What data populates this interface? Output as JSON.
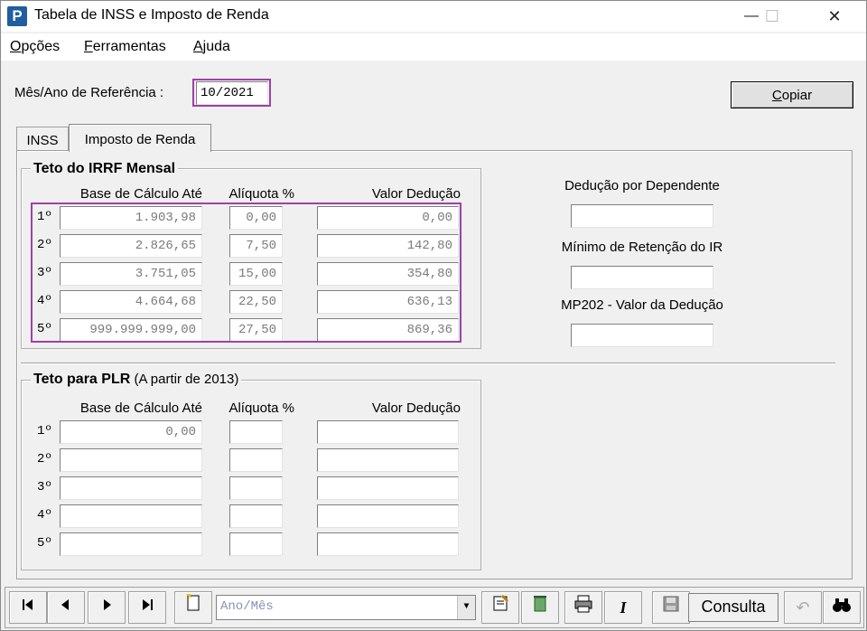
{
  "window": {
    "app_icon": "P",
    "title": "Tabela de INSS e Imposto de Renda",
    "minimize": "—",
    "maximize": "☐",
    "close": "✕"
  },
  "menu": [
    {
      "label": "Opções",
      "underline_char": "O",
      "rest": "pções"
    },
    {
      "label": "Ferramentas",
      "underline_char": "F",
      "rest": "erramentas"
    },
    {
      "label": "Ajuda",
      "underline_char": "A",
      "rest": "juda"
    }
  ],
  "reference": {
    "label": "Mês/Ano de Referência :",
    "value": "10/2021"
  },
  "copy_button": {
    "underline_char": "C",
    "rest": "opiar"
  },
  "tabs": [
    {
      "label": "INSS"
    },
    {
      "label": "Imposto de Renda"
    }
  ],
  "irrf": {
    "title": "Teto do IRRF Mensal",
    "headers": {
      "base": "Base de Cálculo Até",
      "aliquota": "Alíquota %",
      "deducao": "Valor Dedução"
    },
    "rows": [
      {
        "label": "1º",
        "base": "1.903,98",
        "aliquota": "0,00",
        "deducao": "0,00"
      },
      {
        "label": "2º",
        "base": "2.826,65",
        "aliquota": "7,50",
        "deducao": "142,80"
      },
      {
        "label": "3º",
        "base": "3.751,05",
        "aliquota": "15,00",
        "deducao": "354,80"
      },
      {
        "label": "4º",
        "base": "4.664,68",
        "aliquota": "22,50",
        "deducao": "636,13"
      },
      {
        "label": "5º",
        "base": "999.999.999,00",
        "aliquota": "27,50",
        "deducao": "869,36"
      }
    ]
  },
  "plr": {
    "title": "Teto para PLR",
    "subtitle": "(A partir de 2013)",
    "headers": {
      "base": "Base de Cálculo Até",
      "aliquota": "Alíquota %",
      "deducao": "Valor Dedução"
    },
    "rows": [
      {
        "label": "1º",
        "base": "0,00",
        "aliquota": "",
        "deducao": ""
      },
      {
        "label": "2º",
        "base": "",
        "aliquota": "",
        "deducao": ""
      },
      {
        "label": "3º",
        "base": "",
        "aliquota": "",
        "deducao": ""
      },
      {
        "label": "4º",
        "base": "",
        "aliquota": "",
        "deducao": ""
      },
      {
        "label": "5º",
        "base": "",
        "aliquota": "",
        "deducao": ""
      }
    ]
  },
  "side": {
    "dependente_label": "Dedução por Dependente",
    "dependente_value": "",
    "minimo_label": "Mínimo de Retenção do IR",
    "minimo_value": "",
    "mp202_label": "MP202 - Valor da Dedução",
    "mp202_value": ""
  },
  "toolbar": {
    "first": "first-record-icon",
    "prev": "previous-record-icon",
    "next": "next-record-icon",
    "last": "last-record-icon",
    "new": "new-document-icon",
    "combo_placeholder": "Ano/Mês",
    "mode": "Consulta",
    "icons": [
      "edit-document-icon",
      "recycle-delete-icon",
      "printer-icon",
      "italic-icon",
      "save-icon",
      "undo-icon",
      "binoculars-search-icon"
    ]
  }
}
